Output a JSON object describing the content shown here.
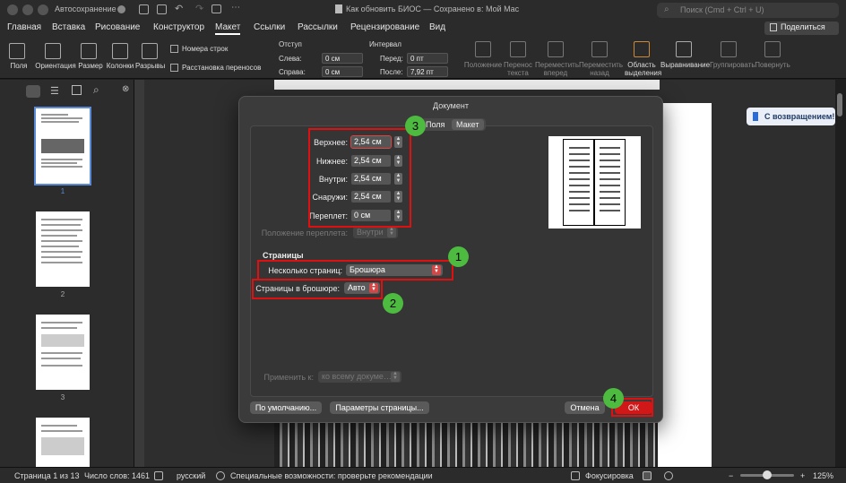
{
  "titlebar": {
    "autosave": "Автосохранение",
    "title": "Как обновить БИОС — Сохранено в: Мой Mac",
    "search": "Поиск (Cmd + Ctrl + U)"
  },
  "tabs": [
    "Главная",
    "Вставка",
    "Рисование",
    "Конструктор",
    "Макет",
    "Ссылки",
    "Рассылки",
    "Рецензирование",
    "Вид"
  ],
  "active_tab": "Макет",
  "share": "Поделиться",
  "ribbon": {
    "buttons": [
      "Поля",
      "Ориентация",
      "Размер",
      "Колонки",
      "Разрывы"
    ],
    "line_numbers": "Номера строк",
    "hyphenation": "Расстановка переносов",
    "indent": {
      "heading": "Отступ",
      "left_label": "Слева:",
      "left": "0 см",
      "right_label": "Справа:",
      "right": "0 см"
    },
    "spacing": {
      "heading": "Интервал",
      "before_label": "Перед:",
      "before": "0 пт",
      "after_label": "После:",
      "after": "7,92 пт"
    },
    "arrange": [
      {
        "l1": "Положение",
        "l2": ""
      },
      {
        "l1": "Перенос",
        "l2": "текста"
      },
      {
        "l1": "Переместить",
        "l2": "вперед"
      },
      {
        "l1": "Переместить",
        "l2": "назад"
      },
      {
        "l1": "Область",
        "l2": "выделения"
      },
      {
        "l1": "Выравнивание",
        "l2": ""
      },
      {
        "l1": "Группировать",
        "l2": ""
      },
      {
        "l1": "Повернуть",
        "l2": ""
      }
    ]
  },
  "thumbnails": [
    "1",
    "2",
    "3"
  ],
  "welcome": "С возвращением!",
  "dialog": {
    "title": "Документ",
    "tabs": [
      "Поля",
      "Макет"
    ],
    "margins": [
      {
        "label": "Верхнее:",
        "value": "2,54 см"
      },
      {
        "label": "Нижнее:",
        "value": "2,54 см"
      },
      {
        "label": "Внутри:",
        "value": "2,54 см"
      },
      {
        "label": "Снаружи:",
        "value": "2,54 см"
      },
      {
        "label": "Переплет:",
        "value": "0 см"
      }
    ],
    "gutter_label": "Положение переплета:",
    "gutter_value": "Внутри",
    "pages_heading": "Страницы",
    "multiple_label": "Несколько страниц:",
    "multiple_value": "Брошюра",
    "booklet_label": "Страницы в брошюре:",
    "booklet_value": "Авто",
    "apply_label": "Применить к:",
    "apply_value": "ко всему докуме…",
    "default_btn": "По умолчанию...",
    "page_setup_btn": "Параметры страницы...",
    "cancel_btn": "Отмена",
    "ok_btn": "ОК"
  },
  "badges": [
    "1",
    "2",
    "3",
    "4"
  ],
  "status": {
    "page": "Страница 1 из 13",
    "words": "Число слов: 1461",
    "lang": "русский",
    "access": "Специальные возможности: проверьте рекомендации",
    "focus": "Фокусировка",
    "zoom": "125%"
  },
  "colors": {
    "highlight": "#e01010",
    "badge": "#4cbb3f"
  }
}
